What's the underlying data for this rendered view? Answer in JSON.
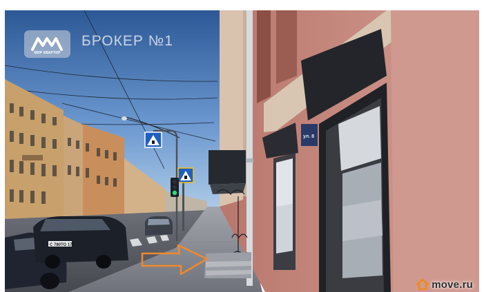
{
  "watermark": {
    "logo_text": "МИР КВАРТИР",
    "title": "БРОКЕР №1"
  },
  "site_badge": {
    "text": "move.ru",
    "icon": "house-icon",
    "icon_color": "#f28a1a"
  },
  "street_sign": {
    "text": "ул. 8"
  },
  "license_plate": {
    "text": "С 780ТО 178"
  },
  "arrow": {
    "color": "#f0892e",
    "direction": "right"
  },
  "palette": {
    "sky_top": "#2f5f9e",
    "sky_bottom": "#9cc0e4",
    "facade_pink": "#c88a80",
    "facade_pink_dark": "#a8675d",
    "sidewalk": "#8e9099",
    "asphalt": "#5c5f66",
    "buildings_left": "#c9a676"
  }
}
